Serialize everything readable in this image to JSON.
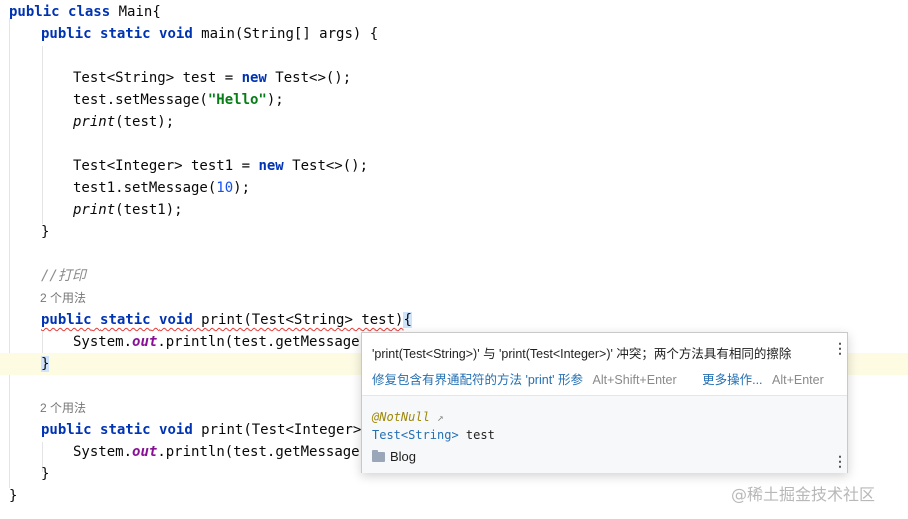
{
  "code": {
    "l1": [
      "public",
      " ",
      "class",
      " Main{"
    ],
    "l2": [
      "public",
      " ",
      "static",
      " ",
      "void",
      " main(String[] args) {"
    ],
    "l4": [
      "Test<String> test = ",
      "new",
      " Test<>();"
    ],
    "l5": [
      "test.setMessage(",
      "\"Hello\"",
      ");"
    ],
    "l6": [
      "print",
      "(test);"
    ],
    "l8": [
      "Test<Integer> test1 = ",
      "new",
      " Test<>();"
    ],
    "l9": [
      "test1.setMessage(",
      "10",
      ");"
    ],
    "l10": [
      "print",
      "(test1);"
    ],
    "l11": "}",
    "l13": "//打印",
    "hint1": "2 个用法",
    "l14": [
      "public static void print(Test<String> test)",
      "{"
    ],
    "l15": [
      "System.",
      "out",
      ".println(test.getMessage()"
    ],
    "l16": "}",
    "hint2": "2 个用法",
    "l18": [
      "public",
      " ",
      "static",
      " ",
      "void",
      " print(Test<Integer> t"
    ],
    "l19": [
      "System.",
      "out",
      ".println(test.getMessage()"
    ],
    "l20": "}",
    "l21": "}"
  },
  "popup": {
    "message": "'print(Test<String>)' 与 'print(Test<Integer>)' 冲突；两个方法具有相同的擦除",
    "fix_action": "修复包含有界通配符的方法 'print' 形参",
    "fix_shortcut": "Alt+Shift+Enter",
    "more_action": "更多操作...",
    "more_shortcut": "Alt+Enter",
    "annotation": "@NotNull",
    "annotation_arrow": "↗",
    "sig_type": "Test",
    "sig_generic": "<String>",
    "sig_rest": " test",
    "module": "Blog"
  },
  "watermark": "@稀土掘金技术社区",
  "colors": {
    "keyword": "#0033b3",
    "string": "#067d17",
    "number": "#1750eb",
    "static_field": "#871094",
    "comment": "#8c8c8c",
    "link": "#2470b3",
    "error_underline": "#e53935",
    "line_highlight": "#fdfbe2"
  }
}
